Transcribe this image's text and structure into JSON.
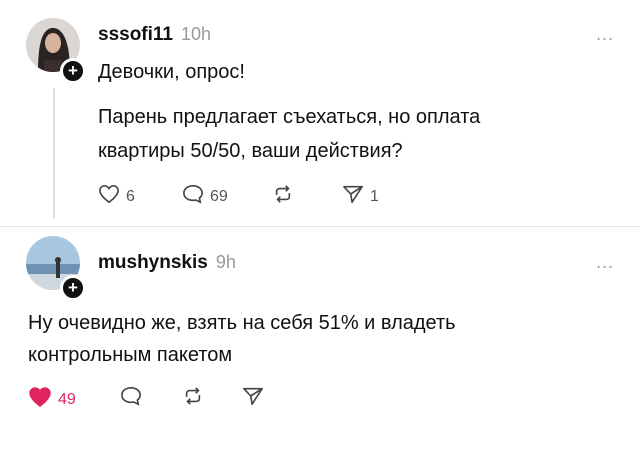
{
  "posts": [
    {
      "username": "sssofi11",
      "time": "10h",
      "more": "...",
      "lines": [
        "Девочки, опрос!",
        "Парень предлагает съехаться, но оплата",
        "квартиры 50/50, ваши действия?"
      ],
      "actions": {
        "likes": "6",
        "replies": "69",
        "repost": "",
        "share": "1"
      }
    },
    {
      "username": "mushynskis",
      "time": "9h",
      "more": "...",
      "lines": [
        "Ну очевидно же, взять на себя 51% и владеть",
        "контрольным пакетом"
      ],
      "actions": {
        "likes": "49",
        "liked": true
      }
    }
  ],
  "icons": {
    "like": "heart-icon",
    "reply": "comment-icon",
    "repost": "repost-icon",
    "share": "send-icon",
    "add": "plus-icon"
  },
  "colors": {
    "liked": "#e0245e",
    "muted": "#9a9a9a"
  }
}
